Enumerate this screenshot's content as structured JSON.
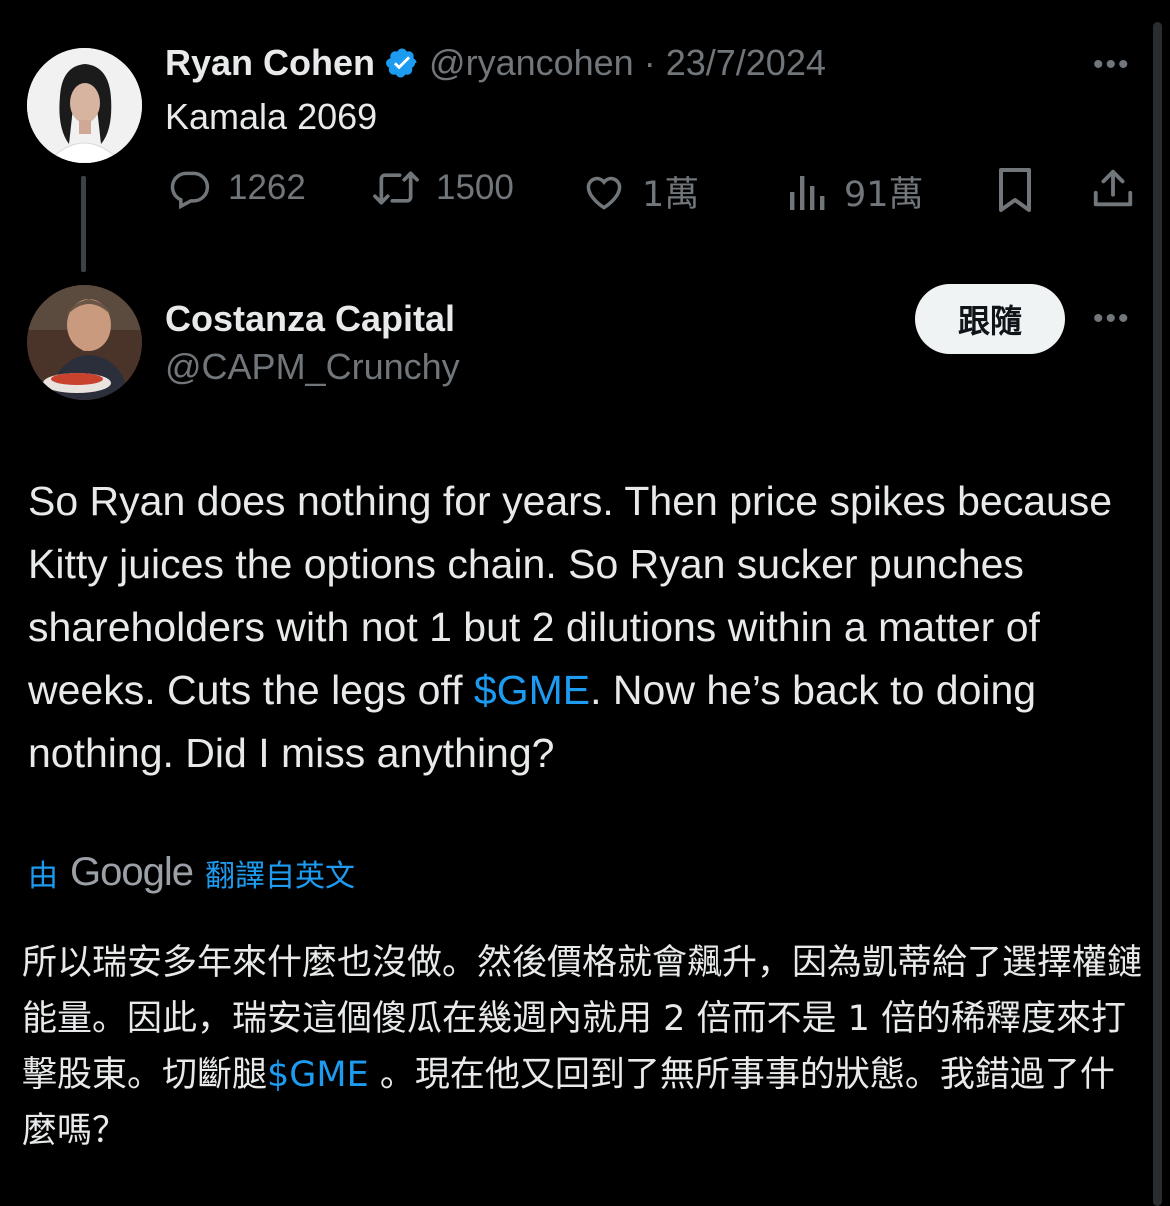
{
  "parent_tweet": {
    "author_name": "Ryan Cohen",
    "verified": true,
    "handle": "@ryancohen",
    "separator": "·",
    "date": "23/7/2024",
    "text": "Kamala 2069",
    "stats": {
      "replies": "1262",
      "reposts": "1500",
      "likes": "1萬",
      "views": "91萬"
    },
    "more_label": "•••"
  },
  "reply_tweet": {
    "author_name": "Costanza Capital",
    "handle": "@CAPM_Crunchy",
    "follow_label": "跟隨",
    "more_label": "•••",
    "text_before_link": "So Ryan does nothing for years. Then price spikes because Kitty juices the options chain. So Ryan sucker punches shareholders with not 1 but 2 dilutions within a matter of weeks. Cuts the legs off ",
    "link_text": "$GME",
    "text_after_link": ". Now he’s back to doing nothing. Did I miss anything?",
    "translation": {
      "prefix": "由",
      "provider": "Google",
      "suffix": "翻譯自英文",
      "text_before_link": "所以瑞安多年來什麼也沒做。然後價格就會飆升，因為凱蒂給了選擇權鏈能量。因此，瑞安這個傻瓜在幾週內就用 2 倍而不是 1 倍的稀釋度來打擊股東。切斷腿",
      "link_text": "$GME",
      "text_after_link": " 。現在他又回到了無所事事的狀態。我錯過了什麼嗎？"
    }
  },
  "colors": {
    "background": "#000000",
    "text": "#e7e9ea",
    "secondary": "#71767b",
    "accent": "#1d9bf0"
  },
  "icons": [
    "verified-badge-icon",
    "reply-icon",
    "repost-icon",
    "like-icon",
    "views-icon",
    "bookmark-icon",
    "share-icon",
    "more-icon"
  ]
}
